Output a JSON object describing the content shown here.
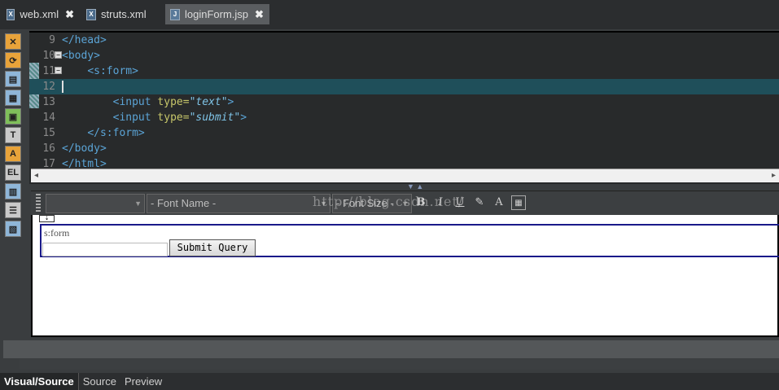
{
  "tabs": [
    {
      "label": "web.xml",
      "icon": "xml-file-icon",
      "active": false,
      "closable": true
    },
    {
      "label": "struts.xml",
      "icon": "xml-file-icon",
      "active": false,
      "closable": false
    },
    {
      "label": "loginForm.jsp",
      "icon": "jsp-file-icon",
      "active": true,
      "closable": true
    }
  ],
  "tab_close_glyph": "✖",
  "editor": {
    "lines": [
      {
        "num": "9",
        "html": "<span class='tag'>&lt;/head&gt;</span>",
        "fold": false
      },
      {
        "num": "10",
        "html": "<span class='tag'>&lt;body&gt;</span>",
        "fold": true
      },
      {
        "num": "11",
        "html": "    <span class='tag'>&lt;s:form&gt;</span>",
        "fold": true
      },
      {
        "num": "12",
        "html": "",
        "fold": false,
        "current": true
      },
      {
        "num": "13",
        "html": "        <span class='tag'>&lt;input</span> <span class='attr'>type=</span><span class='str'>\"text\"</span><span class='tag'>&gt;</span>",
        "fold": false
      },
      {
        "num": "14",
        "html": "        <span class='tag'>&lt;input</span> <span class='attr'>type=</span><span class='str'>\"submit\"</span><span class='tag'>&gt;</span>",
        "fold": false
      },
      {
        "num": "15",
        "html": "    <span class='tag'>&lt;/s:form&gt;</span>",
        "fold": false
      },
      {
        "num": "16",
        "html": "<span class='tag'>&lt;/body&gt;</span>",
        "fold": false
      },
      {
        "num": "17",
        "html": "<span class='tag'>&lt;/html&gt;</span>",
        "fold": false
      }
    ]
  },
  "format_toolbar": {
    "style_select": "",
    "font_name_select": "- Font Name -",
    "font_size_select": "- Font Size -",
    "bold": "B",
    "italic": "I",
    "underline": "U",
    "watermark": "http://blog.csdn.net/"
  },
  "canvas": {
    "form_label": "s:form",
    "submit_label": "Submit Query",
    "toggle_glyph": "⇣"
  },
  "bottom_tabs": [
    {
      "label": "Visual/Source",
      "active": true
    },
    {
      "label": "Source",
      "active": false
    },
    {
      "label": "Preview",
      "active": false
    }
  ]
}
